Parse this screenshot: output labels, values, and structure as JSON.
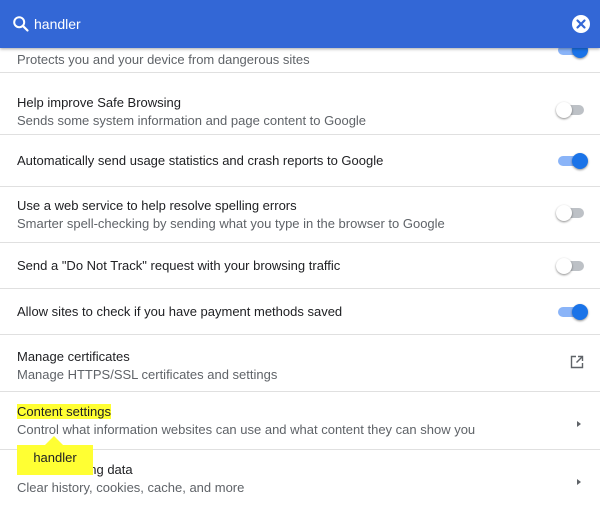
{
  "search": {
    "value": "handler",
    "clear_label": "Clear search"
  },
  "rows": [
    {
      "title": "",
      "subtitle": "Protects you and your device from dangerous sites",
      "control": "toggle",
      "state": "on"
    },
    {
      "title": "Help improve Safe Browsing",
      "subtitle": "Sends some system information and page content to Google",
      "control": "toggle",
      "state": "off"
    },
    {
      "title": "Automatically send usage statistics and crash reports to Google",
      "subtitle": "",
      "control": "toggle",
      "state": "on"
    },
    {
      "title": "Use a web service to help resolve spelling errors",
      "subtitle": "Smarter spell-checking by sending what you type in the browser to Google",
      "control": "toggle",
      "state": "off"
    },
    {
      "title": "Send a \"Do Not Track\" request with your browsing traffic",
      "subtitle": "",
      "control": "toggle",
      "state": "off"
    },
    {
      "title": "Allow sites to check if you have payment methods saved",
      "subtitle": "",
      "control": "toggle",
      "state": "on"
    },
    {
      "title": "Manage certificates",
      "subtitle": "Manage HTTPS/SSL certificates and settings",
      "control": "external-link-icon"
    },
    {
      "title": "Content settings",
      "subtitle": "Control what information websites can use and what content they can show you",
      "control": "chevron-right-icon"
    },
    {
      "title": "Clear browsing data",
      "subtitle": "Clear history, cookies, cache, and more",
      "control": "chevron-right-icon"
    }
  ],
  "tooltip": {
    "text": "handler"
  },
  "colors": {
    "header": "#3367d6",
    "toggle_on": "#1a73e8",
    "toggle_on_track": "#8ab4f8",
    "toggle_off_track": "#bdc1c6",
    "highlight": "#ffff33"
  }
}
